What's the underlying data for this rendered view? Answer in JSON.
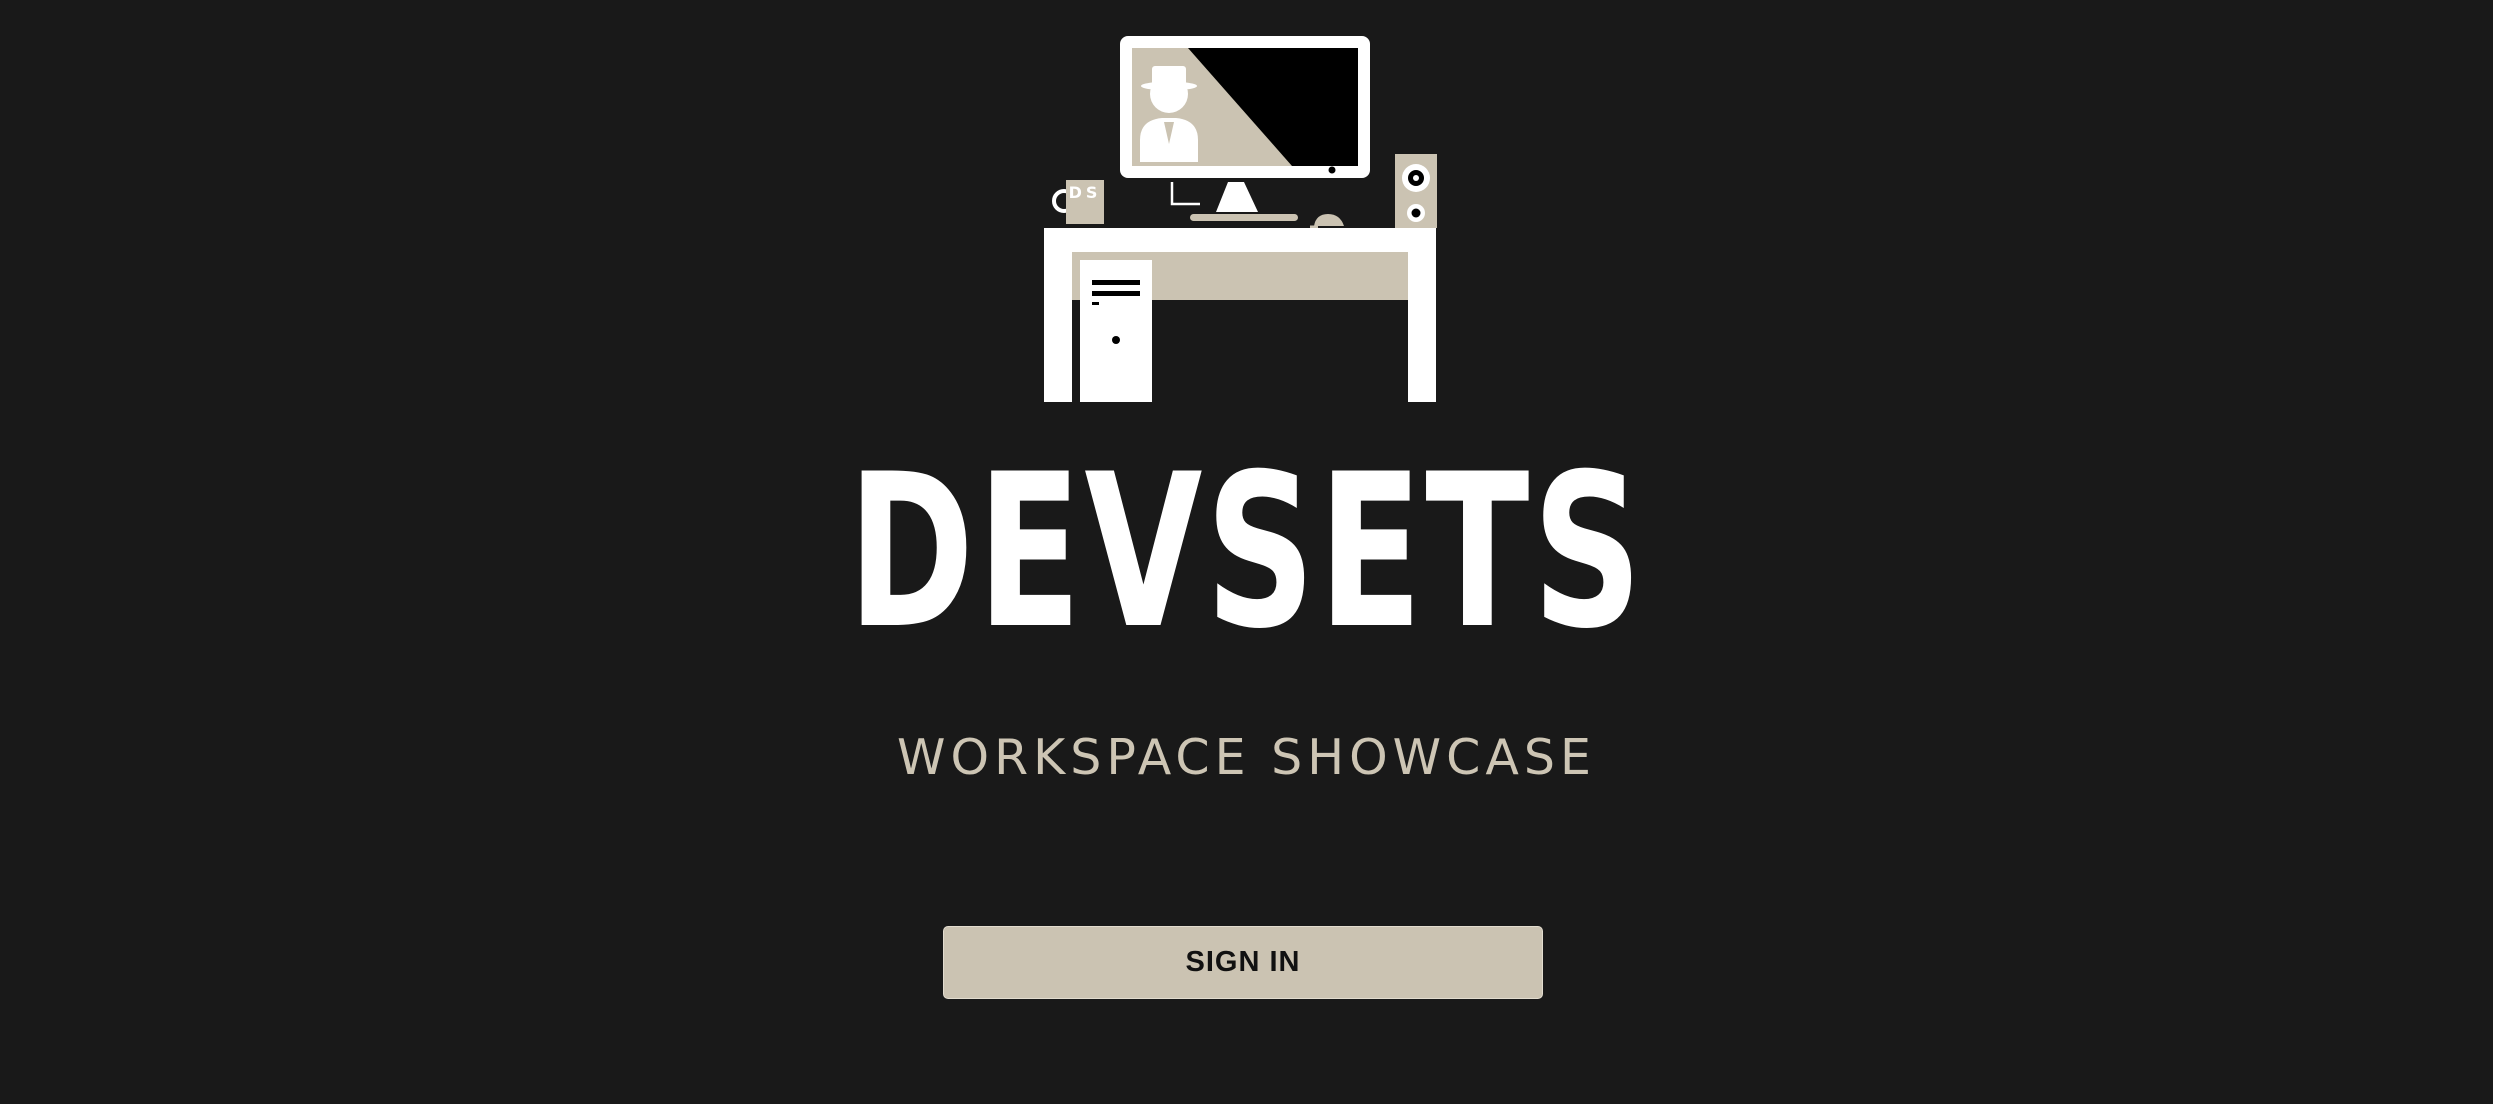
{
  "brand": {
    "title": "DEVSETS",
    "subtitle": "WORKSPACE SHOWCASE",
    "logo_mug_text": "DS"
  },
  "actions": {
    "signin_label": "SIGN IN"
  },
  "colors": {
    "background": "#191919",
    "accent": "#cbc3b2",
    "title": "#ffffff",
    "button_text": "#111111"
  },
  "icons": {
    "logo": "desk-workstation-logo-icon"
  }
}
